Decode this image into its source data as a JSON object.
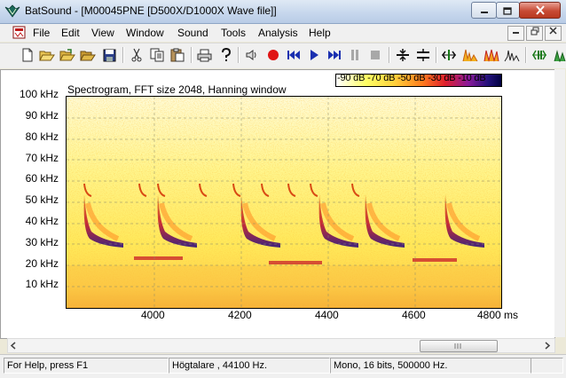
{
  "window": {
    "title": "BatSound - [M00045PNE [D500X/D1000X Wave file]]",
    "accent": "#c5d6ec"
  },
  "menu": {
    "items": [
      "File",
      "Edit",
      "View",
      "Window",
      "Sound",
      "Tools",
      "Analysis",
      "Help"
    ]
  },
  "toolbar": {
    "icons": [
      "new-icon",
      "open-icon",
      "open-folder-icon",
      "save-icon",
      "cut-icon",
      "copy-icon",
      "paste-icon",
      "print-icon",
      "help-icon",
      "speaker-icon",
      "record-icon",
      "rewind-icon",
      "play-icon",
      "fast-forward-icon",
      "pause-icon",
      "stop-icon",
      "zoom-in-icon",
      "zoom-out-icon",
      "marker-icon",
      "spectrum-icon",
      "spectrogram-icon",
      "power-spectrum-icon",
      "pulse-icon"
    ]
  },
  "spectrogram": {
    "title": "Spectrogram, FFT size 2048, Hanning window",
    "legend": "-90 dB -70 dB -50 dB -30 dB -10 dB",
    "y_ticks": [
      "100 kHz",
      "90 kHz",
      "80 kHz",
      "70 kHz",
      "60 kHz",
      "50 kHz",
      "40 kHz",
      "30 kHz",
      "20 kHz",
      "10 kHz"
    ],
    "x_ticks": [
      "4000",
      "4200",
      "4400",
      "4600",
      "4800 ms"
    ]
  },
  "status": {
    "help": "For Help, press F1",
    "output": "Högtalare ,  44100 Hz.",
    "format": "Mono, 16 bits, 500000 Hz."
  }
}
